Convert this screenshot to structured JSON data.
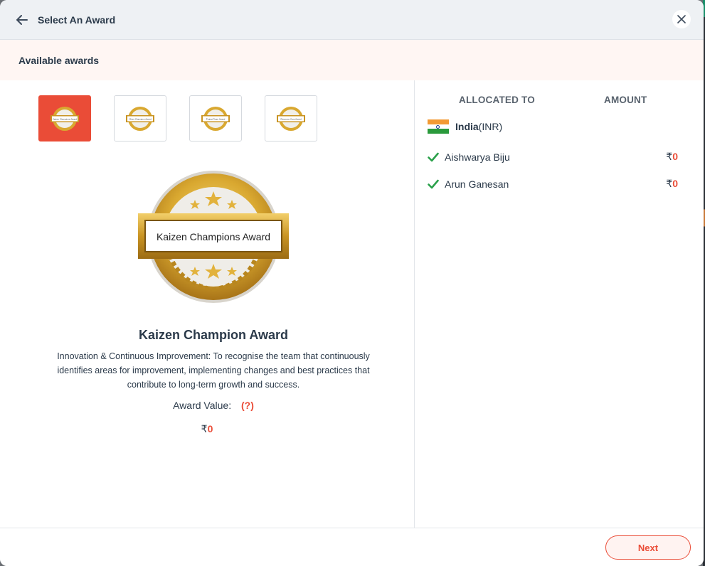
{
  "header": {
    "title": "Select An Award"
  },
  "subheader": {
    "title": "Available awards"
  },
  "award_options": [
    {
      "banner": "Kaizen Champions Award"
    },
    {
      "banner": "Client Champion Award"
    },
    {
      "banner": "Project Team Award"
    },
    {
      "banner": "Resource Care Award"
    }
  ],
  "selected_award": {
    "banner": "Kaizen Champions Award",
    "name": "Kaizen Champion Award",
    "description": "Innovation & Continuous Improvement: To recognise the team that continuously identifies areas for improvement, implementing changes and best practices that contribute to long-term growth and success.",
    "value_label": "Award Value:",
    "help": "(?)",
    "currency": "₹",
    "amount": "0"
  },
  "allocation": {
    "col_allocated": "ALLOCATED TO",
    "col_amount": "AMOUNT",
    "country": "India",
    "country_currency": "(INR)",
    "people": [
      {
        "name": "Aishwarya Biju",
        "currency": "₹",
        "amount": "0"
      },
      {
        "name": "Arun Ganesan",
        "currency": "₹",
        "amount": "0"
      }
    ]
  },
  "footer": {
    "next_label": "Next"
  },
  "colors": {
    "accent": "#ea4c37",
    "text": "#2b3a4a",
    "check": "#2aa04a",
    "gold": "#d9a830"
  }
}
